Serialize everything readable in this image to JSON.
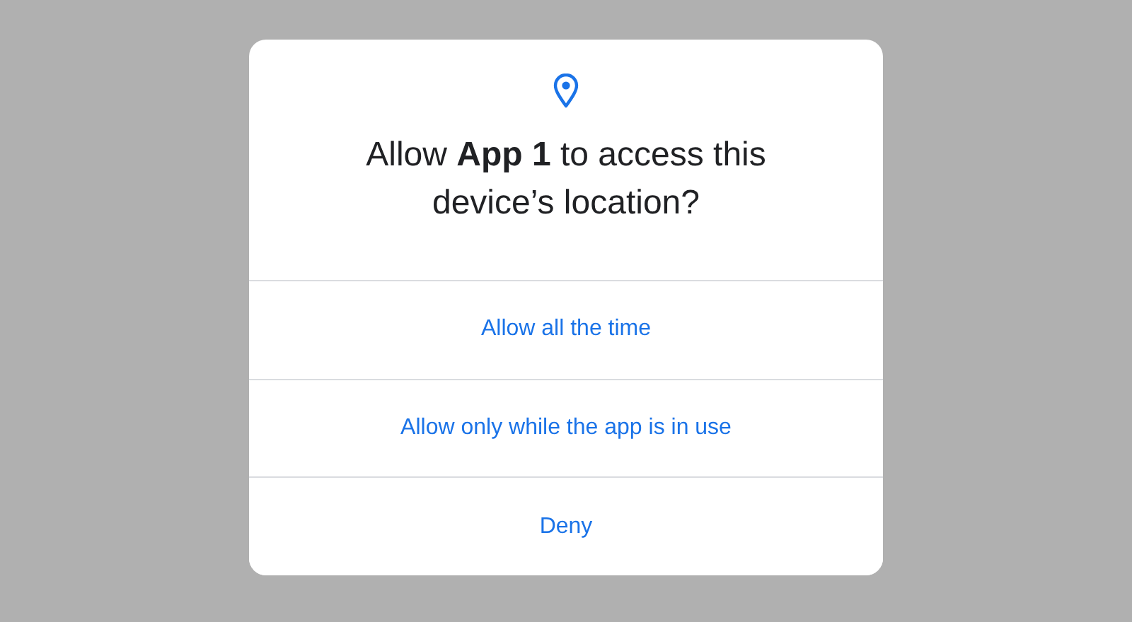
{
  "dialog": {
    "title": "Allow **App 1** to access this device’s location?",
    "buttons": [
      {
        "label": "Allow all the time"
      },
      {
        "label": "Allow only while the app is in use"
      },
      {
        "label": "Deny"
      }
    ]
  }
}
